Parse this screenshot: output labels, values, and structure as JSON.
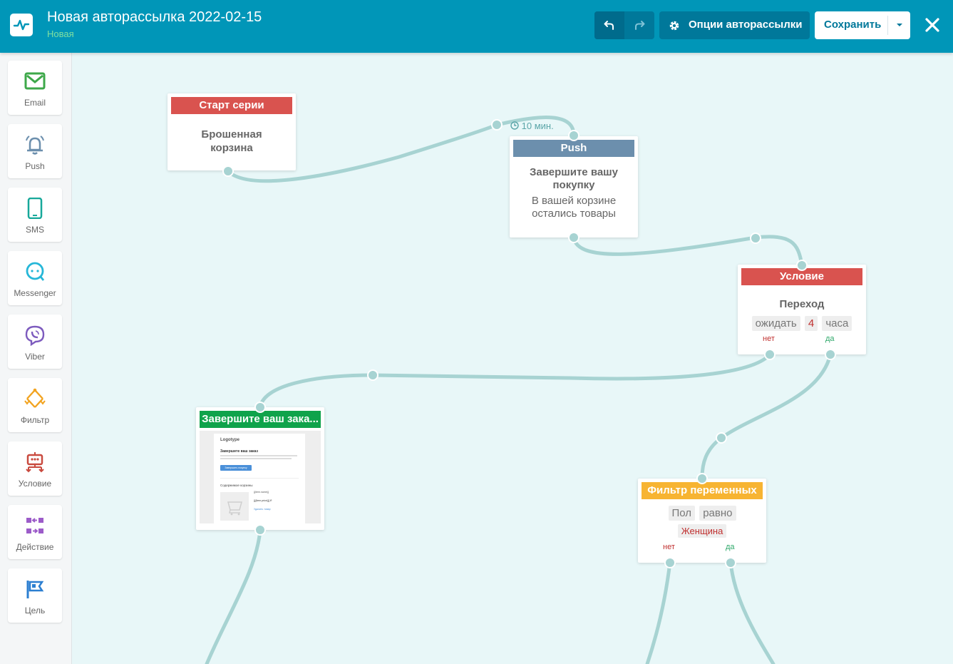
{
  "header": {
    "title": "Новая авторассылка 2022-02-15",
    "status": "Новая",
    "options_label": "Опции авторассылки",
    "save_label": "Сохранить"
  },
  "colors": {
    "header": "#0096b8",
    "start": "#d9534f",
    "push": "#6c8fad",
    "condition": "#d9534f",
    "email": "#0fa34b",
    "filter": "#f7b432",
    "wire": "#a7d3d2"
  },
  "sidebar": {
    "items": [
      {
        "label": "Email",
        "icon": "envelope-icon"
      },
      {
        "label": "Push",
        "icon": "bell-icon"
      },
      {
        "label": "SMS",
        "icon": "phone-icon"
      },
      {
        "label": "Messenger",
        "icon": "chat-icon"
      },
      {
        "label": "Viber",
        "icon": "viber-icon"
      },
      {
        "label": "Фильтр",
        "icon": "filter-icon"
      },
      {
        "label": "Условие",
        "icon": "robot-icon"
      },
      {
        "label": "Действие",
        "icon": "action-icon"
      },
      {
        "label": "Цель",
        "icon": "flag-icon"
      }
    ]
  },
  "nodes": {
    "start": {
      "header": "Старт серии",
      "line1": "Брошенная",
      "line2": "корзина"
    },
    "delay": {
      "text": "10 мин."
    },
    "push": {
      "header": "Push",
      "title1": "Завершите вашу",
      "title2": "покупку",
      "body1": "В вашей корзине",
      "body2": "остались товары"
    },
    "condition": {
      "header": "Условие",
      "title": "Переход",
      "wait": "ожидать",
      "amount": "4",
      "unit": "часа",
      "no": "нет",
      "yes": "да"
    },
    "email": {
      "header": "Завершите ваш зака...",
      "preview": {
        "logo": "Logotype",
        "heading": "Завершите ваш заказ",
        "button": "Завершить покупку",
        "cart_title": "Содержимое корзины",
        "item_name": "{{item.name}}",
        "item_price": "{{{item.price}}} ₽",
        "link": "Удалить товар"
      }
    },
    "filter": {
      "header": "Фильтр переменных",
      "field": "Пол",
      "op": "равно",
      "value": "Женщина",
      "no": "нет",
      "yes": "да"
    }
  }
}
